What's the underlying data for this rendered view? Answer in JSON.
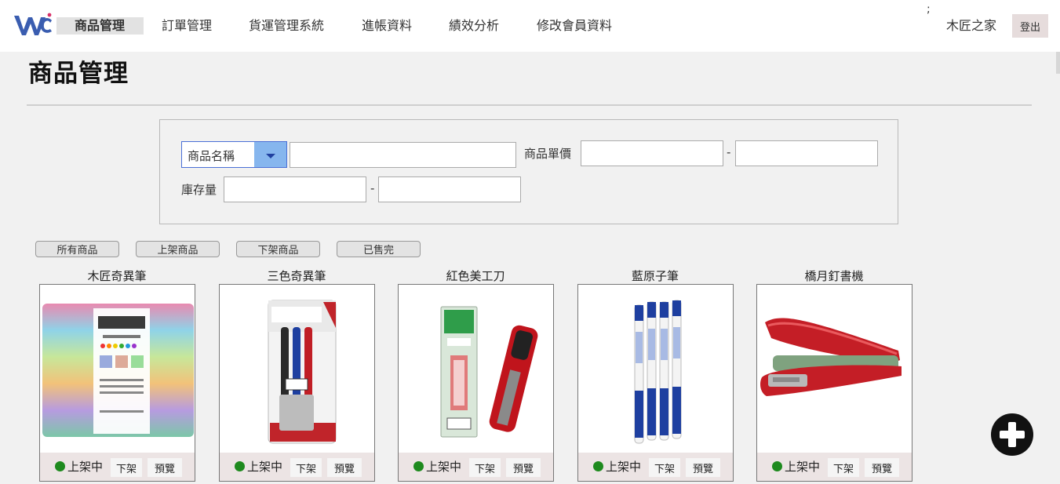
{
  "nav": {
    "items": [
      {
        "label": "商品管理",
        "active": true
      },
      {
        "label": "訂單管理"
      },
      {
        "label": "貨運管理系統"
      },
      {
        "label": "進帳資料"
      },
      {
        "label": "績效分析"
      },
      {
        "label": "修改會員資料"
      }
    ],
    "semicolon": ";",
    "user_name": "木匠之家",
    "logout_label": "登出"
  },
  "page": {
    "title": "商品管理"
  },
  "filters": {
    "field_select": "商品名稱",
    "name_input_value": "",
    "price_label": "商品單價",
    "price_min": "",
    "price_max": "",
    "stock_label": "庫存量",
    "stock_min": "",
    "stock_max": "",
    "range_dash": "-"
  },
  "status_tabs": [
    "所有商品",
    "上架商品",
    "下架商品",
    "已售完"
  ],
  "products": [
    {
      "name": "木匠奇異筆",
      "status": "上架中",
      "take_down_label": "下架",
      "preview_label": "預覽",
      "image": "marker-pack-image"
    },
    {
      "name": "三色奇異筆",
      "status": "上架中",
      "take_down_label": "下架",
      "preview_label": "預覽",
      "image": "sharpie-pack-image"
    },
    {
      "name": "紅色美工刀",
      "status": "上架中",
      "take_down_label": "下架",
      "preview_label": "預覽",
      "image": "utility-knife-image"
    },
    {
      "name": "藍原子筆",
      "status": "上架中",
      "take_down_label": "下架",
      "preview_label": "預覽",
      "image": "blue-pens-image"
    },
    {
      "name": "橋月釘書機",
      "status": "上架中",
      "take_down_label": "下架",
      "preview_label": "預覽",
      "image": "stapler-image"
    }
  ],
  "colors": {
    "status_dot": "#1e8a1e",
    "select_arrow_bg": "#86b6ee",
    "select_border": "#4a6fd6",
    "logout_bg": "#e6dcdc"
  },
  "icons": {
    "logo": "wc-logo-icon",
    "add": "plus-circle-icon",
    "dropdown": "chevron-down-icon"
  }
}
